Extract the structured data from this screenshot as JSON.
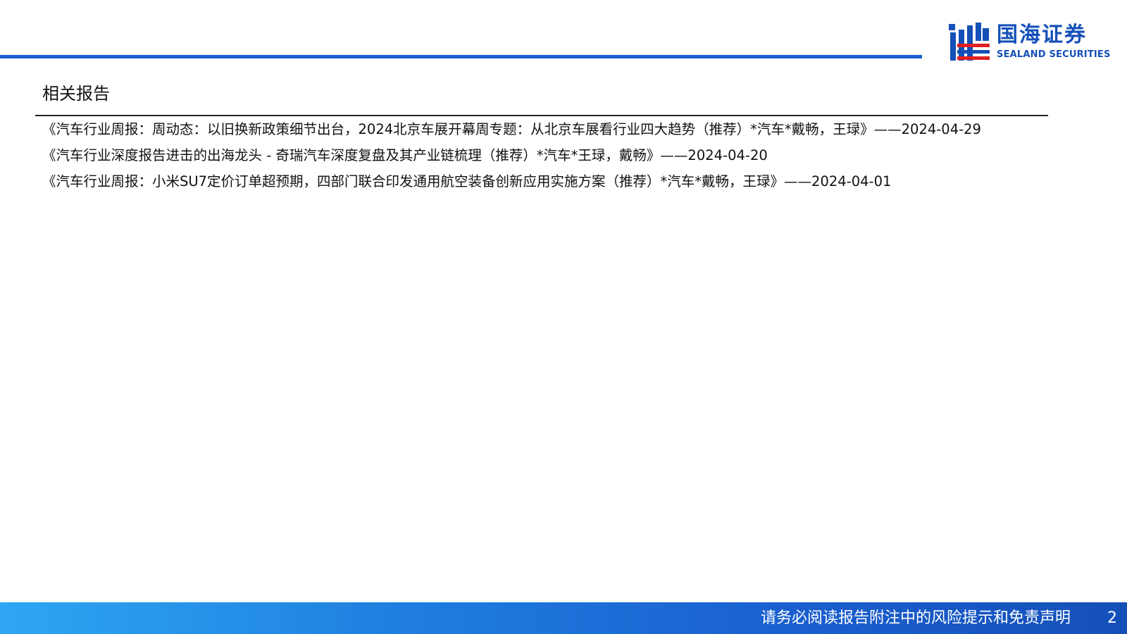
{
  "header": {
    "brand": {
      "name_cn": "国海证券",
      "name_en": "SEALAND SECURITIES",
      "primary_color": "#1550b8",
      "accent_color": "#e02020",
      "icon": "sealand-logo-icon"
    },
    "rule_color": "#1a5fd0"
  },
  "section": {
    "title": "相关报告"
  },
  "reports": [
    {
      "text": "《汽车行业周报：周动态：以旧换新政策细节出台，2024北京车展开幕周专题：从北京车展看行业四大趋势（推荐）*汽车*戴畅，王琭》——2024-04-29"
    },
    {
      "text": "《汽车行业深度报告进击的出海龙头 - 奇瑞汽车深度复盘及其产业链梳理（推荐）*汽车*王琭，戴畅》——2024-04-20"
    },
    {
      "text": "《汽车行业周报：小米SU7定价订单超预期，四部门联合印发通用航空装备创新应用实施方案（推荐）*汽车*戴畅，王琭》——2024-04-01"
    }
  ],
  "footer": {
    "disclaimer": "请务必阅读报告附注中的风险提示和免责声明",
    "page_number": "2"
  }
}
